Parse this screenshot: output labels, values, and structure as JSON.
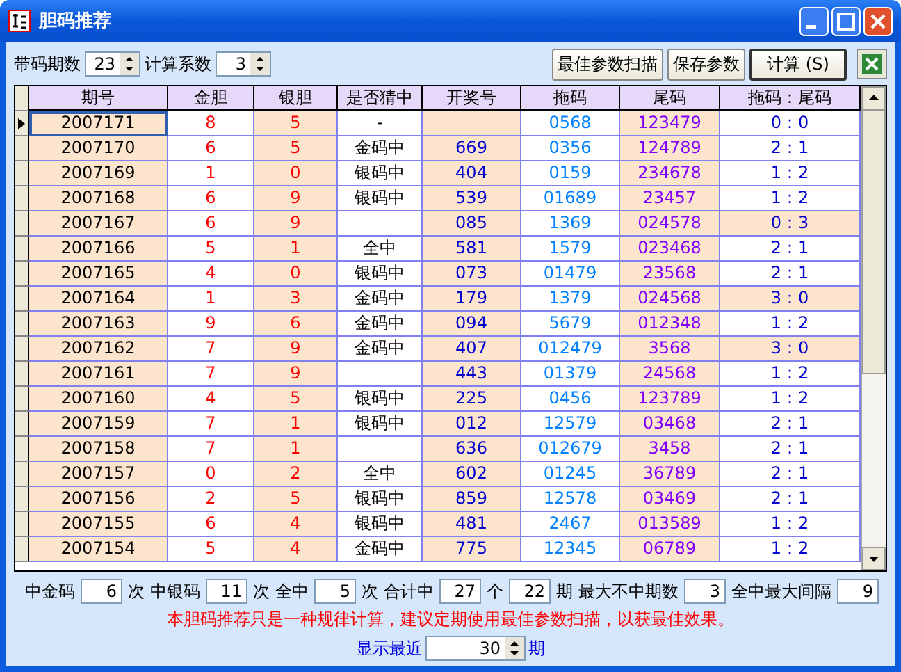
{
  "window": {
    "title": "胆码推荐"
  },
  "toolbar": {
    "period_label": "带码期数",
    "period_value": "23",
    "coef_label": "计算系数",
    "coef_value": "3",
    "buttons": [
      "最佳参数扫描",
      "保存参数",
      "计算 (S)"
    ]
  },
  "table": {
    "columns": [
      "期号",
      "金胆",
      "银胆",
      "是否猜中",
      "开奖号",
      "拖码",
      "尾码",
      "拖码：尾码"
    ],
    "rows": [
      {
        "period": "2007171",
        "gold": "8",
        "silver": "5",
        "hit": "-",
        "draw": "",
        "drag": "0568",
        "tail": "123479",
        "ratio": "0：0",
        "ratio_highlighted": false,
        "current": true
      },
      {
        "period": "2007170",
        "gold": "6",
        "silver": "5",
        "hit": "金码中",
        "draw": "669",
        "drag": "0356",
        "tail": "124789",
        "ratio": "2：1",
        "ratio_highlighted": false,
        "current": false
      },
      {
        "period": "2007169",
        "gold": "1",
        "silver": "0",
        "hit": "银码中",
        "draw": "404",
        "drag": "0159",
        "tail": "234678",
        "ratio": "1：2",
        "ratio_highlighted": false,
        "current": false
      },
      {
        "period": "2007168",
        "gold": "6",
        "silver": "9",
        "hit": "银码中",
        "draw": "539",
        "drag": "01689",
        "tail": "23457",
        "ratio": "1：2",
        "ratio_highlighted": false,
        "current": false
      },
      {
        "period": "2007167",
        "gold": "6",
        "silver": "9",
        "hit": "",
        "draw": "085",
        "drag": "1369",
        "tail": "024578",
        "ratio": "0：3",
        "ratio_highlighted": true,
        "current": false
      },
      {
        "period": "2007166",
        "gold": "5",
        "silver": "1",
        "hit": "全中",
        "draw": "581",
        "drag": "1579",
        "tail": "023468",
        "ratio": "2：1",
        "ratio_highlighted": false,
        "current": false
      },
      {
        "period": "2007165",
        "gold": "4",
        "silver": "0",
        "hit": "银码中",
        "draw": "073",
        "drag": "01479",
        "tail": "23568",
        "ratio": "2：1",
        "ratio_highlighted": false,
        "current": false
      },
      {
        "period": "2007164",
        "gold": "1",
        "silver": "3",
        "hit": "金码中",
        "draw": "179",
        "drag": "1379",
        "tail": "024568",
        "ratio": "3：0",
        "ratio_highlighted": true,
        "current": false
      },
      {
        "period": "2007163",
        "gold": "9",
        "silver": "6",
        "hit": "金码中",
        "draw": "094",
        "drag": "5679",
        "tail": "012348",
        "ratio": "1：2",
        "ratio_highlighted": false,
        "current": false
      },
      {
        "period": "2007162",
        "gold": "7",
        "silver": "9",
        "hit": "金码中",
        "draw": "407",
        "drag": "012479",
        "tail": "3568",
        "ratio": "3：0",
        "ratio_highlighted": true,
        "current": false
      },
      {
        "period": "2007161",
        "gold": "7",
        "silver": "9",
        "hit": "",
        "draw": "443",
        "drag": "01379",
        "tail": "24568",
        "ratio": "1：2",
        "ratio_highlighted": false,
        "current": false
      },
      {
        "period": "2007160",
        "gold": "4",
        "silver": "5",
        "hit": "银码中",
        "draw": "225",
        "drag": "0456",
        "tail": "123789",
        "ratio": "1：2",
        "ratio_highlighted": false,
        "current": false
      },
      {
        "period": "2007159",
        "gold": "7",
        "silver": "1",
        "hit": "银码中",
        "draw": "012",
        "drag": "12579",
        "tail": "03468",
        "ratio": "2：1",
        "ratio_highlighted": false,
        "current": false
      },
      {
        "period": "2007158",
        "gold": "7",
        "silver": "1",
        "hit": "",
        "draw": "636",
        "drag": "012679",
        "tail": "3458",
        "ratio": "2：1",
        "ratio_highlighted": false,
        "current": false
      },
      {
        "period": "2007157",
        "gold": "0",
        "silver": "2",
        "hit": "全中",
        "draw": "602",
        "drag": "01245",
        "tail": "36789",
        "ratio": "2：1",
        "ratio_highlighted": false,
        "current": false
      },
      {
        "period": "2007156",
        "gold": "2",
        "silver": "5",
        "hit": "银码中",
        "draw": "859",
        "drag": "12578",
        "tail": "03469",
        "ratio": "2：1",
        "ratio_highlighted": false,
        "current": false
      },
      {
        "period": "2007155",
        "gold": "6",
        "silver": "4",
        "hit": "银码中",
        "draw": "481",
        "drag": "2467",
        "tail": "013589",
        "ratio": "1：2",
        "ratio_highlighted": false,
        "current": false
      },
      {
        "period": "2007154",
        "gold": "5",
        "silver": "4",
        "hit": "金码中",
        "draw": "775",
        "drag": "12345",
        "tail": "06789",
        "ratio": "1：2",
        "ratio_highlighted": false,
        "current": false
      }
    ]
  },
  "stats": [
    {
      "kind": "label",
      "text": "中金码"
    },
    {
      "kind": "field",
      "text": "6"
    },
    {
      "kind": "label",
      "text": "次"
    },
    {
      "kind": "label",
      "text": "中银码"
    },
    {
      "kind": "field",
      "text": "11"
    },
    {
      "kind": "label",
      "text": "次"
    },
    {
      "kind": "label",
      "text": "全中"
    },
    {
      "kind": "field",
      "text": "5"
    },
    {
      "kind": "label",
      "text": "次"
    },
    {
      "kind": "label",
      "text": "合计中"
    },
    {
      "kind": "field",
      "text": "27"
    },
    {
      "kind": "label",
      "text": "个"
    },
    {
      "kind": "field",
      "text": "22"
    },
    {
      "kind": "label",
      "text": "期"
    },
    {
      "kind": "label",
      "text": "最大不中期数"
    },
    {
      "kind": "field",
      "text": "3"
    },
    {
      "kind": "label",
      "text": "全中最大间隔"
    },
    {
      "kind": "field",
      "text": "9"
    }
  ],
  "note": "本胆码推荐只是一种规律计算，建议定期使用最佳参数扫描，以获最佳效果。",
  "recent": {
    "label": "显示最近",
    "value": "30",
    "unit": "期"
  }
}
